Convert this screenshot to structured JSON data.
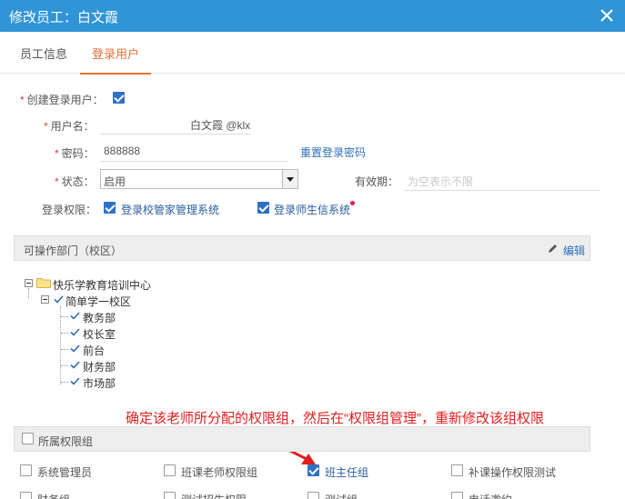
{
  "dialog": {
    "title": "修改员工：白文霞"
  },
  "tabs": [
    {
      "label": "员工信息",
      "active": false
    },
    {
      "label": "登录用户",
      "active": true
    }
  ],
  "form": {
    "create_login_label": "创建登录用户：",
    "create_login_checked": true,
    "username_label": "用户名：",
    "username_value": "白文霞 @klx",
    "password_label": "密码：",
    "password_value": "888888",
    "reset_password_link": "重置登录密码",
    "status_label": "状态：",
    "status_value": "启用",
    "expiry_label": "有效期：",
    "expiry_placeholder": "为空表示不限",
    "permissions_label": "登录权限：",
    "permissions": [
      {
        "label": "登录校管家管理系统",
        "checked": true
      },
      {
        "label": "登录师生信系统",
        "checked": true
      }
    ]
  },
  "departments_section": {
    "title": "可操作部门（校区）",
    "edit_label": "编辑",
    "tree": {
      "root": "快乐学教育培训中心",
      "campus": "简单学一校区",
      "children": [
        "教务部",
        "校长室",
        "前台",
        "财务部",
        "市场部"
      ]
    }
  },
  "annotation": "确定该老师所分配的权限组，然后在“权限组管理”，重新修改该组权限",
  "permission_groups_section": {
    "title": "所属权限组",
    "groups": [
      {
        "label": "系统管理员",
        "checked": false
      },
      {
        "label": "班课老师权限组",
        "checked": false
      },
      {
        "label": "班主任组",
        "checked": true
      },
      {
        "label": "补课操作权限测试",
        "checked": false
      },
      {
        "label": "财务组",
        "checked": false
      },
      {
        "label": "测试招生权限",
        "checked": false
      },
      {
        "label": "测试组",
        "checked": false
      },
      {
        "label": "电话邀约",
        "checked": false
      }
    ]
  },
  "colors": {
    "header": "#2f95d6",
    "active_tab": "#e8703a",
    "annotation": "#e02020",
    "checkbox": "#2f72c4"
  }
}
